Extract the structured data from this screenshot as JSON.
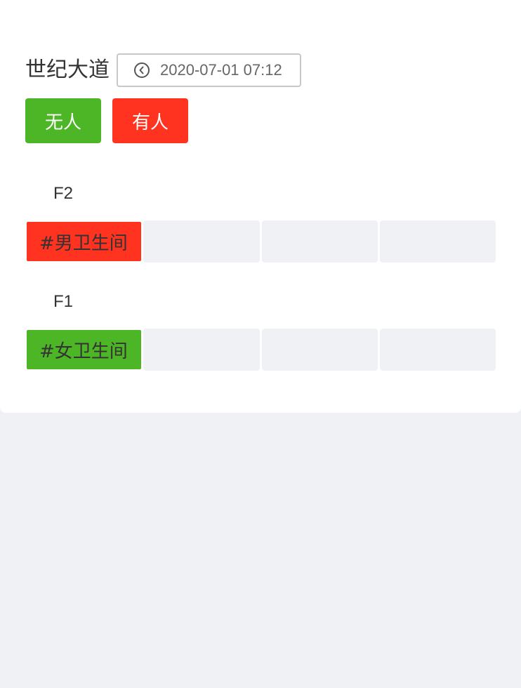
{
  "header": {
    "location": "世纪大道",
    "clock_icon": "clock-back-icon",
    "datetime": "2020-07-01 07:12"
  },
  "legend": {
    "free_label": "无人",
    "occupied_label": "有人",
    "free_color": "#4db627",
    "occupied_color": "#ff3320"
  },
  "floors": [
    {
      "label": "F2",
      "room": {
        "name": "#男卫生间",
        "status": "occupied"
      }
    },
    {
      "label": "F1",
      "room": {
        "name": "#女卫生间",
        "status": "free"
      }
    }
  ]
}
